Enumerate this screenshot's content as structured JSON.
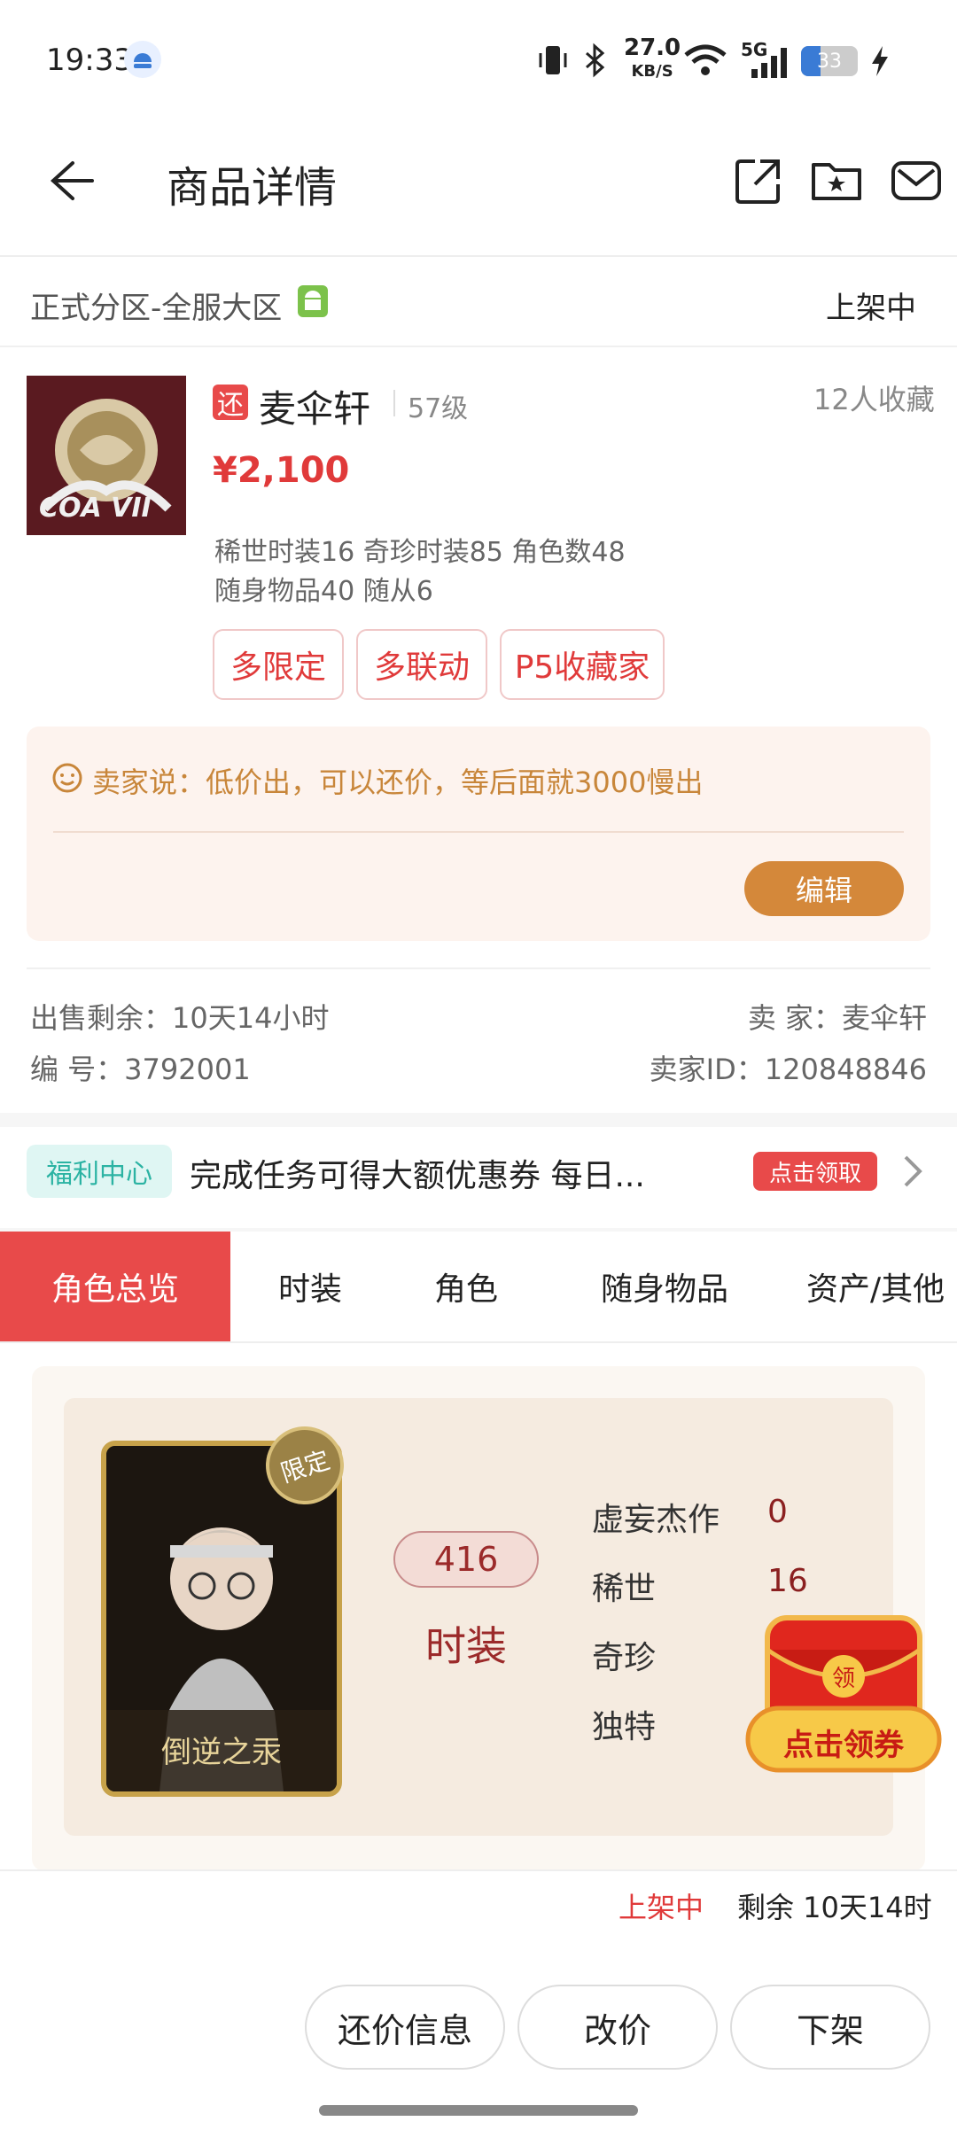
{
  "status_bar": {
    "time": "19:33",
    "net_speed_top": "27.0",
    "net_speed_unit": "KB/S",
    "signal": "5G",
    "battery": "33"
  },
  "header": {
    "title": "商品详情"
  },
  "server": {
    "name": "正式分区-全服大区",
    "status": "上架中"
  },
  "item": {
    "badge": "还",
    "name": "麦伞轩",
    "level": "57级",
    "favorites": "12人收藏",
    "price": "¥2,100",
    "desc_line1": "稀世时装16 奇珍时装85 角色数48",
    "desc_line2": "随身物品40 随从6",
    "tags": [
      "多限定",
      "多联动",
      "P5收藏家"
    ],
    "cover_text": "COA VII"
  },
  "seller_note": {
    "label": "卖家说：低价出，可以还价，等后面就3000慢出",
    "edit_button": "编辑"
  },
  "meta": {
    "remain_label": "出售剩余：10天14小时",
    "id_label": "编 号：3792001",
    "seller_label": "卖 家：麦伞轩",
    "seller_id_label": "卖家ID：120848846"
  },
  "welfare": {
    "badge": "福利中心",
    "text": "完成任务可得大额优惠券 每日...",
    "cta": "点击领取"
  },
  "tabs": [
    "角色总览",
    "时装",
    "角色",
    "随身物品",
    "资产/其他"
  ],
  "overview": {
    "card_badge": "限定",
    "card_name": "倒逆之汞",
    "count": "416",
    "count_label": "时装",
    "stats": [
      {
        "label": "虚妄杰作",
        "value": "0"
      },
      {
        "label": "稀世",
        "value": "16"
      },
      {
        "label": "奇珍",
        "value": ""
      },
      {
        "label": "独特",
        "value": ""
      }
    ]
  },
  "coupon_float": {
    "badge": "领",
    "label": "点击领券"
  },
  "footer": {
    "status": "上架中",
    "remain": "剩余 10天14时",
    "buttons": [
      "还价信息",
      "改价",
      "下架"
    ]
  },
  "colors": {
    "accent_red": "#e84a4a",
    "price_red": "#e03a3a",
    "note_bg": "#fdf3ee",
    "note_text": "#c8863a",
    "edit_btn": "#d4883a",
    "welfare_badge_bg": "#dff6f3",
    "welfare_badge_text": "#2bb3a3",
    "overview_bg": "#f5ebe0",
    "count_text": "#9b2a2a"
  }
}
